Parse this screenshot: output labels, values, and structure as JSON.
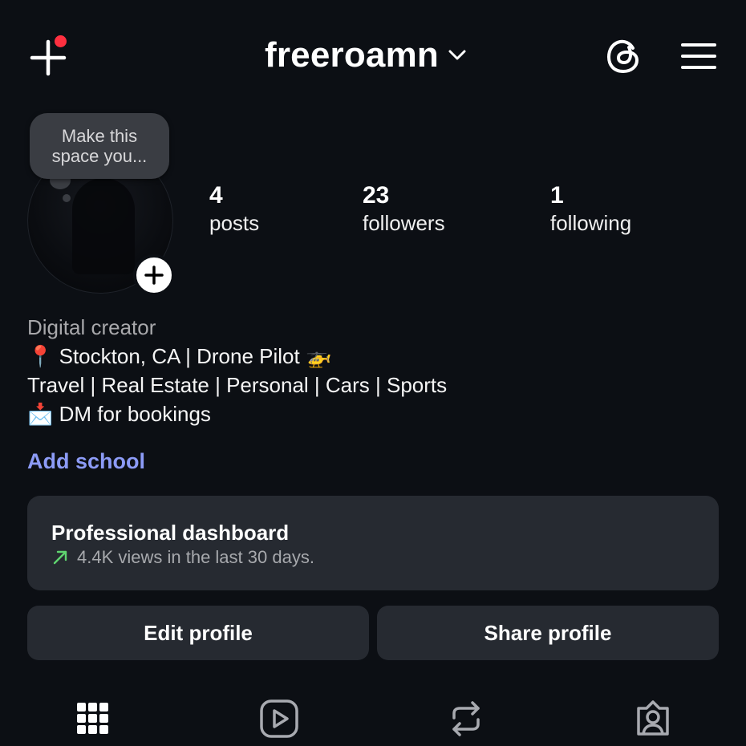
{
  "header": {
    "username": "freeroamn",
    "create_icon": "plus-icon",
    "threads_icon": "threads-icon",
    "menu_icon": "hamburger-menu-icon",
    "notification_dot_color": "#ff3040"
  },
  "note": {
    "text_line1": "Make this",
    "text_line2": "space you..."
  },
  "stats": {
    "posts": {
      "value": "4",
      "label": "posts"
    },
    "followers": {
      "value": "23",
      "label": "followers"
    },
    "following": {
      "value": "1",
      "label": "following"
    }
  },
  "bio": {
    "category": "Digital creator",
    "line1_emoji": "📍",
    "line1": "Stockton, CA | Drone Pilot",
    "line1_end_emoji": "🚁",
    "line2": "Travel | Real Estate | Personal | Cars | Sports",
    "line3_emoji": "📩",
    "line3": "DM for bookings"
  },
  "add_school": "Add school",
  "dashboard": {
    "title": "Professional dashboard",
    "subtitle": "4.4K views in the last 30 days.",
    "trend_color": "#5fd46f"
  },
  "buttons": {
    "edit": "Edit profile",
    "share": "Share profile"
  },
  "tabs": [
    "grid-icon",
    "reels-icon",
    "reposts-icon",
    "tagged-icon"
  ],
  "colors": {
    "background": "#0c0f14",
    "link": "#8c9bf6",
    "card": "#262a31"
  }
}
